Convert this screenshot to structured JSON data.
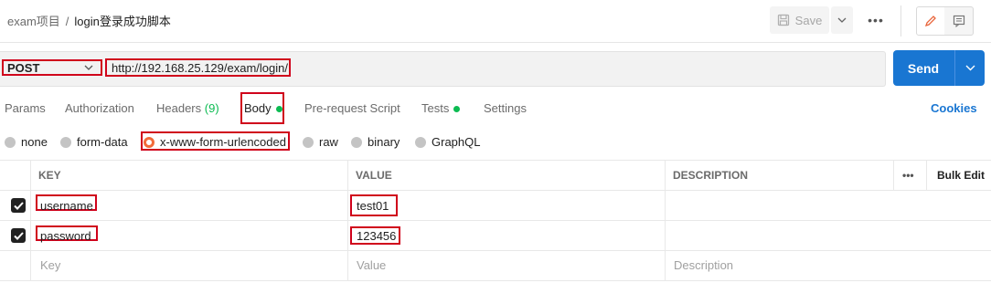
{
  "header": {
    "breadcrumb_parent": "exam项目",
    "breadcrumb_sep": "/",
    "breadcrumb_current": "login登录成功脚本",
    "save_label": "Save",
    "more_label": "•••"
  },
  "request": {
    "method": "POST",
    "url": "http://192.168.25.129/exam/login/",
    "send_label": "Send"
  },
  "tabs": [
    {
      "label": "Params"
    },
    {
      "label": "Authorization"
    },
    {
      "label": "Headers",
      "count": "(9)"
    },
    {
      "label": "Body"
    },
    {
      "label": "Pre-request Script"
    },
    {
      "label": "Tests"
    },
    {
      "label": "Settings"
    }
  ],
  "cookies_label": "Cookies",
  "body_types": [
    "none",
    "form-data",
    "x-www-form-urlencoded",
    "raw",
    "binary",
    "GraphQL"
  ],
  "body_selected": "x-www-form-urlencoded",
  "table": {
    "headers": {
      "key": "KEY",
      "value": "VALUE",
      "description": "DESCRIPTION",
      "more": "•••",
      "bulk_edit": "Bulk Edit"
    },
    "rows": [
      {
        "key": "username",
        "value": "test01",
        "checked": true
      },
      {
        "key": "password",
        "value": "123456",
        "checked": true
      }
    ],
    "placeholders": {
      "key": "Key",
      "value": "Value",
      "description": "Description"
    }
  },
  "colors": {
    "accent": "#1976d2",
    "highlight": "#d0021b",
    "status_dot": "#0cbb52",
    "selected_radio": "#f26b3a"
  }
}
